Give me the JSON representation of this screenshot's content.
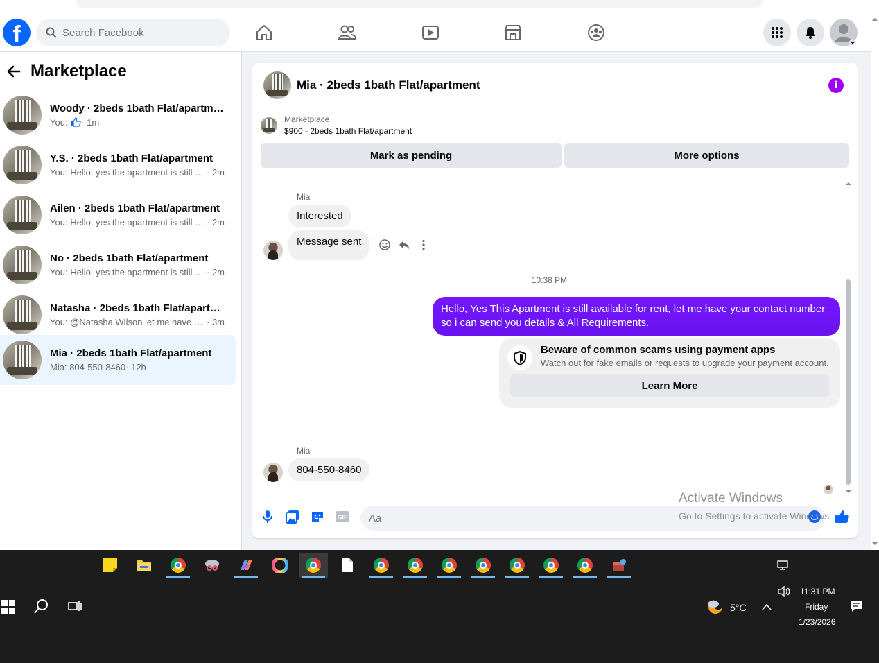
{
  "header": {
    "search_placeholder": "Search Facebook",
    "logo_letter": "f",
    "brand_color": "#0866ff"
  },
  "sidebar": {
    "title": "Marketplace",
    "conversations": [
      {
        "title": "Woody · 2beds 1bath Flat/apartme...",
        "prefix": "You:",
        "snippet": "",
        "time": "· 1m",
        "has_like": true
      },
      {
        "title": "Y.S. · 2beds 1bath Flat/apartment",
        "prefix": "You:",
        "snippet": "Hello, yes the apartment is still a...",
        "time": "· 2m"
      },
      {
        "title": "Ailen · 2beds 1bath Flat/apartment",
        "prefix": "You:",
        "snippet": "Hello, yes the apartment is still a...",
        "time": "· 2m"
      },
      {
        "title": "No · 2beds 1bath Flat/apartment",
        "prefix": "You:",
        "snippet": "Hello, yes the apartment is still a...",
        "time": "· 2m"
      },
      {
        "title": "Natasha · 2beds 1bath Flat/apartm...",
        "prefix": "You:",
        "snippet": "@Natasha Wilson let me have y...",
        "time": "· 3m"
      },
      {
        "title": "Mia · 2beds 1bath Flat/apartment",
        "prefix": "Mia:",
        "snippet": "804-550-8460",
        "time": "· 12h",
        "active": true
      }
    ]
  },
  "chat": {
    "title": "Mia · 2beds 1bath Flat/apartment",
    "info_glyph": "i",
    "listing_label": "Marketplace",
    "listing_price": "$900 - 2beds 1bath Flat/apartment",
    "mark_pending": "Mark as pending",
    "more_options": "More options",
    "messages": {
      "sender1": "Mia",
      "msg1": "Interested",
      "msg2": "Message sent",
      "timestamp": "10:38 PM",
      "outgoing": "Hello, Yes This Apartment is still available for rent, let me have your contact number so i can send you details & All Requirements.",
      "scam_title": "Beware of common scams using payment apps",
      "scam_sub": "Watch out for fake emails or requests to upgrade your payment account.",
      "learn_more": "Learn More",
      "sender2": "Mia",
      "msg3": "804-550-8460"
    },
    "composer_placeholder": "Aa",
    "accent_color": "#7517ff"
  },
  "watermark": {
    "line1": "Activate Windows",
    "line2": "Go to Settings to activate Windows."
  },
  "taskbar": {
    "weather_temp": "5°C",
    "time": "11:31 PM",
    "day": "Friday",
    "date": "1/23/2026"
  }
}
